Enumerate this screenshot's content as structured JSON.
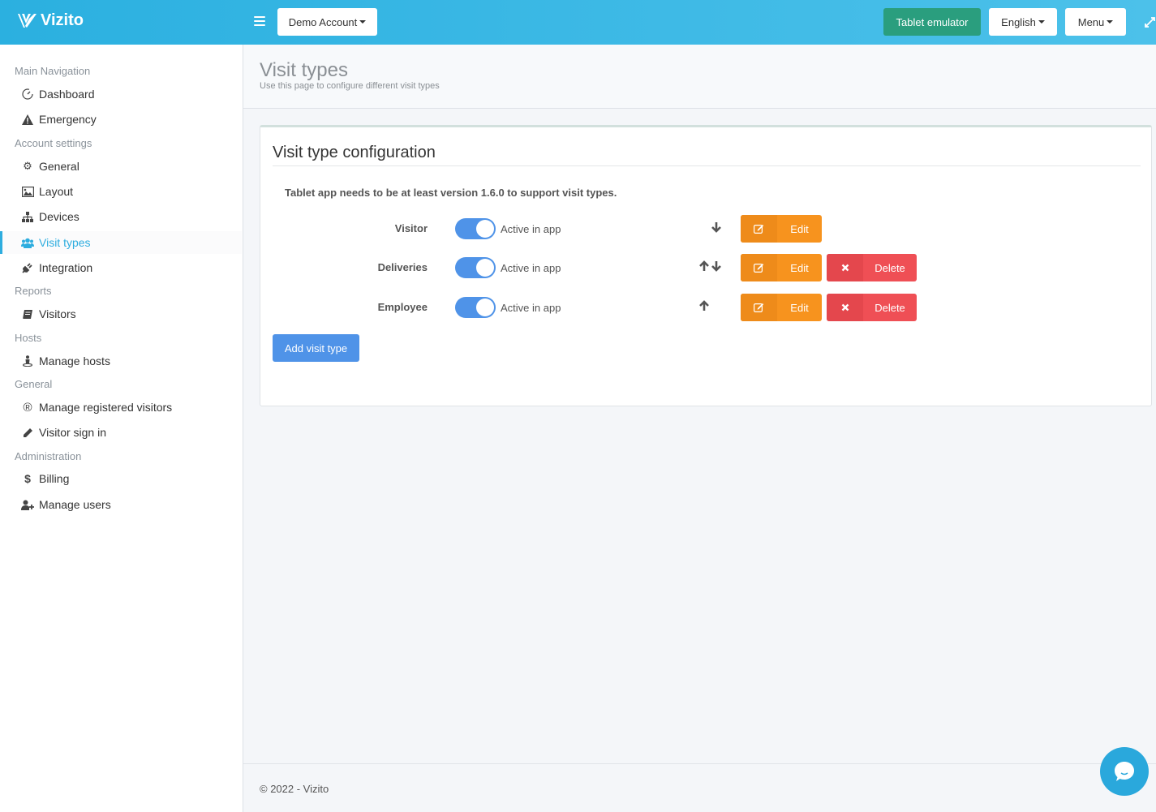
{
  "header": {
    "brand": "Vizito",
    "account_label": "Demo Account",
    "tablet_emulator_label": "Tablet emulator",
    "language_label": "English",
    "menu_label": "Menu",
    "colors": {
      "bar": "#2bb0e0",
      "tablet_button": "#2a9e7e"
    }
  },
  "sidebar": {
    "sections": [
      {
        "title": "Main Navigation",
        "items": [
          {
            "label": "Dashboard",
            "icon": "dashboard-icon"
          },
          {
            "label": "Emergency",
            "icon": "warning-icon"
          }
        ]
      },
      {
        "title": "Account settings",
        "items": [
          {
            "label": "General",
            "icon": "gear-icon"
          },
          {
            "label": "Layout",
            "icon": "image-icon"
          },
          {
            "label": "Devices",
            "icon": "sitemap-icon"
          },
          {
            "label": "Visit types",
            "icon": "users-icon",
            "active": true
          },
          {
            "label": "Integration",
            "icon": "plug-icon"
          }
        ]
      },
      {
        "title": "Reports",
        "items": [
          {
            "label": "Visitors",
            "icon": "book-icon"
          }
        ]
      },
      {
        "title": "Hosts",
        "items": [
          {
            "label": "Manage hosts",
            "icon": "host-icon"
          }
        ]
      },
      {
        "title": "General",
        "items": [
          {
            "label": "Manage registered visitors",
            "icon": "registered-icon"
          },
          {
            "label": "Visitor sign in",
            "icon": "pencil-icon"
          }
        ]
      },
      {
        "title": "Administration",
        "items": [
          {
            "label": "Billing",
            "icon": "dollar-icon"
          },
          {
            "label": "Manage users",
            "icon": "user-plus-icon"
          }
        ]
      }
    ],
    "active_color": "#2eaddf"
  },
  "page": {
    "title": "Visit types",
    "subtitle": "Use this page to configure different visit types"
  },
  "box": {
    "title": "Visit type configuration",
    "notice": "Tablet app needs to be at least version 1.6.0 to support visit types.",
    "visit_types": [
      {
        "name": "Visitor",
        "active": true,
        "active_label": "Active in app",
        "can_move_up": false,
        "can_move_down": true,
        "edit_label": "Edit",
        "deletable": false
      },
      {
        "name": "Deliveries",
        "active": true,
        "active_label": "Active in app",
        "can_move_up": true,
        "can_move_down": true,
        "edit_label": "Edit",
        "deletable": true,
        "delete_label": "Delete"
      },
      {
        "name": "Employee",
        "active": true,
        "active_label": "Active in app",
        "can_move_up": true,
        "can_move_down": false,
        "edit_label": "Edit",
        "deletable": true,
        "delete_label": "Delete"
      }
    ],
    "add_button_label": "Add visit type",
    "colors": {
      "edit": "#f7931e",
      "delete": "#ef4f55",
      "primary": "#4f93e8"
    }
  },
  "footer": {
    "text": "© 2022 - Vizito"
  }
}
